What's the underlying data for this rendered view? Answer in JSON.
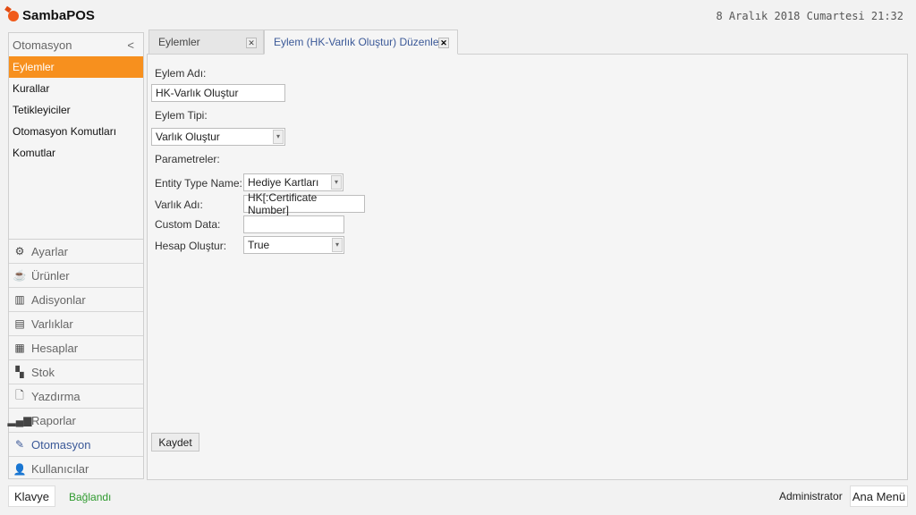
{
  "header": {
    "app_name": "SambaPOS",
    "datetime": "8 Aralık 2018 Cumartesi 21:32"
  },
  "sidebar": {
    "title": "Otomasyon",
    "collapse": "<",
    "items": [
      {
        "label": "Eylemler"
      },
      {
        "label": "Kurallar"
      },
      {
        "label": "Tetikleyiciler"
      },
      {
        "label": "Otomasyon Komutları"
      },
      {
        "label": "Komutlar"
      }
    ]
  },
  "nav": [
    {
      "label": "Ayarlar",
      "icon": "gear-icon"
    },
    {
      "label": "Ürünler",
      "icon": "cup-icon"
    },
    {
      "label": "Adisyonlar",
      "icon": "books-icon"
    },
    {
      "label": "Varlıklar",
      "icon": "table-icon"
    },
    {
      "label": "Hesaplar",
      "icon": "calculator-icon"
    },
    {
      "label": "Stok",
      "icon": "stock-icon"
    },
    {
      "label": "Yazdırma",
      "icon": "document-icon"
    },
    {
      "label": "Raporlar",
      "icon": "bar-chart-icon"
    },
    {
      "label": "Otomasyon",
      "icon": "pen-icon"
    },
    {
      "label": "Kullanıcılar",
      "icon": "user-icon"
    }
  ],
  "tabs": [
    {
      "label": "Eylemler"
    },
    {
      "label": "Eylem (HK-Varlık Oluştur) Düzenle"
    }
  ],
  "form": {
    "name_label": "Eylem Adı:",
    "name_value": "HK-Varlık Oluştur",
    "type_label": "Eylem Tipi:",
    "type_value": "Varlık Oluştur",
    "params_label": "Parametreler:",
    "params": [
      {
        "label": "Entity Type Name:",
        "value": "Hediye Kartları"
      },
      {
        "label": "Varlık Adı:",
        "value": "HK[:Certificate Number]"
      },
      {
        "label": "Custom Data:",
        "value": ""
      },
      {
        "label": "Hesap Oluştur:",
        "value": "True"
      }
    ],
    "save": "Kaydet"
  },
  "footer": {
    "keyboard": "Klavye",
    "status": "Bağlandı",
    "user": "Administrator",
    "main_menu": "Ana Menü"
  },
  "colors": {
    "accent": "#f7901e",
    "status": "#2e9a2e"
  }
}
